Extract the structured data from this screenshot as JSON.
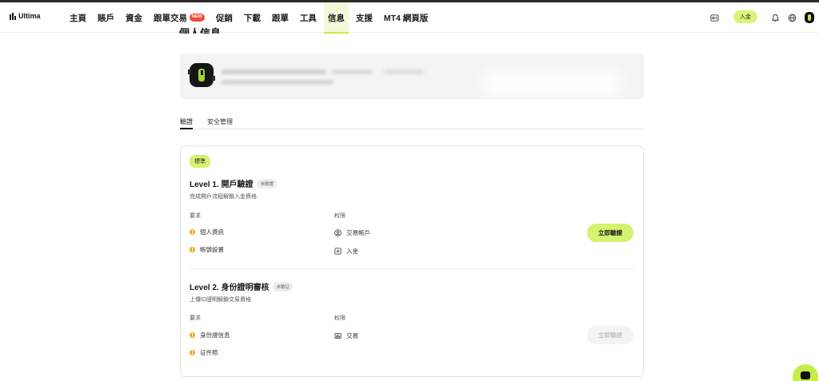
{
  "brand": {
    "logo_text": "Ultima"
  },
  "nav": {
    "items": [
      "主頁",
      "賬戶",
      "資金",
      "跟單交易",
      "促銷",
      "下載",
      "跟單",
      "工具",
      "信息",
      "支援",
      "MT4 網頁版"
    ],
    "new_badge": "NEW",
    "active_index": 8
  },
  "header_right": {
    "deposit_label": "入金"
  },
  "page": {
    "section_title": "個人信息"
  },
  "tabs": [
    {
      "label": "驗證"
    },
    {
      "label": "安全管理"
    }
  ],
  "verification": {
    "standard_badge": "標準",
    "levels": [
      {
        "title": "Level 1. 開戶驗證",
        "status": "未驗證",
        "description": "完成開戶流程解鎖入金資格",
        "requirements_header": "要求",
        "permissions_header": "权限",
        "requirements": [
          "個人資訊",
          "帳號設置"
        ],
        "permissions": [
          "交易帳戶",
          "入金"
        ],
        "button_label": "立即驗證",
        "button_enabled": true
      },
      {
        "title": "Level 2. 身份證明審核",
        "status": "未驗证",
        "description": "上傳ID證明解鎖交易資格",
        "requirements_header": "要求",
        "permissions_header": "权限",
        "requirements": [
          "身份證信息",
          "证件照"
        ],
        "permissions": [
          "交易"
        ],
        "button_label": "立即驗證",
        "button_enabled": false
      }
    ]
  },
  "colors": {
    "accent": "#c6ec48",
    "badge_new": "#ef4c3b",
    "warning_dot": "#f0a81f"
  }
}
